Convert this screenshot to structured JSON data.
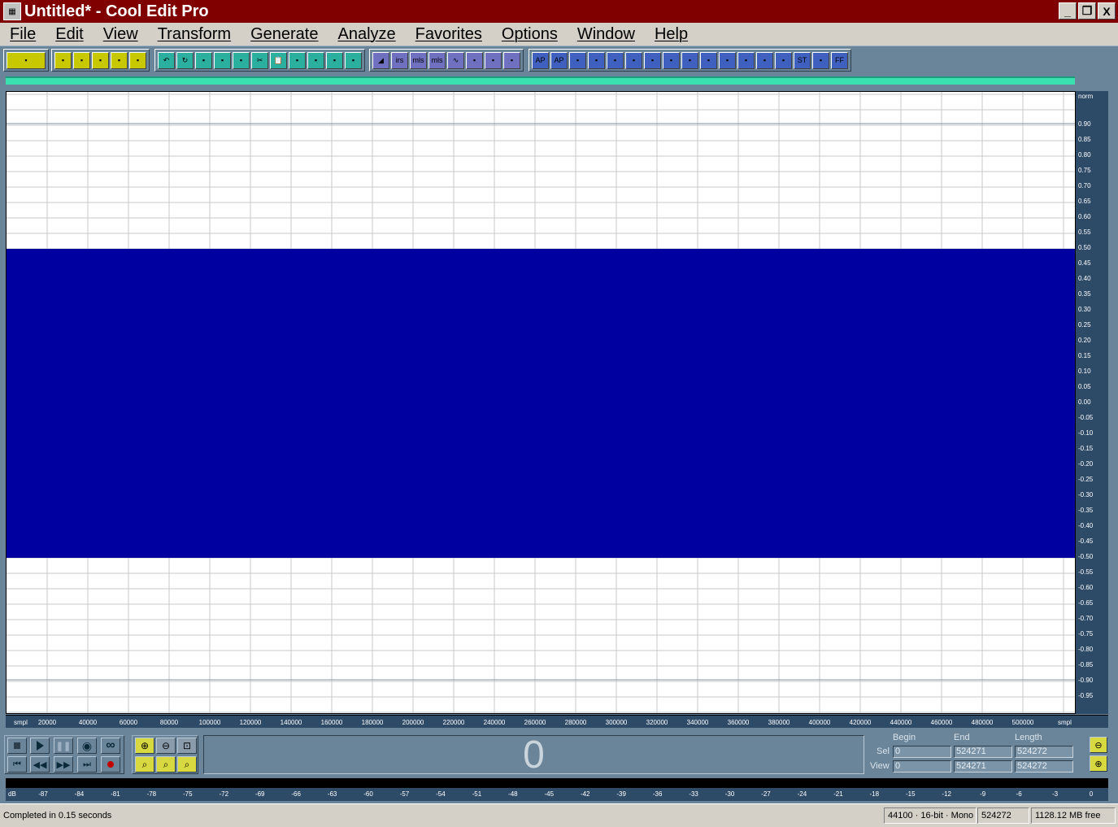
{
  "window": {
    "title": "Untitled* - Cool Edit Pro",
    "controls": [
      "_",
      "❐",
      "X"
    ]
  },
  "menu": [
    "File",
    "Edit",
    "View",
    "Transform",
    "Generate",
    "Analyze",
    "Favorites",
    "Options",
    "Window",
    "Help"
  ],
  "toolbar": {
    "groups": [
      {
        "name": "mode",
        "color": "#c8c800",
        "buttons": [
          "multitrack-view"
        ]
      },
      {
        "name": "file",
        "color": "#c8c800",
        "buttons": [
          "new-file",
          "open-file",
          "close-file",
          "save-file",
          "save-all"
        ]
      },
      {
        "name": "edit",
        "color": "#2bb0a0",
        "buttons": [
          "undo",
          "repeat",
          "cut-marker",
          "select-all",
          "copy-to-new",
          "cut",
          "paste",
          "paste-mix",
          "paste-new",
          "trim",
          "crop"
        ]
      },
      {
        "name": "effects-a",
        "color": "#7070c0",
        "buttons": [
          "amplify",
          "irs",
          "mls",
          "mls2",
          "envelope",
          "noise-reduction",
          "convolution",
          "stretch"
        ]
      },
      {
        "name": "effects-b",
        "color": "#4060c0",
        "buttons": [
          "ap",
          "ap32",
          "wave-b",
          "ratio",
          "ratio-b",
          "flag-1",
          "flag-2",
          "flag-3",
          "flag-4",
          "flag-5",
          "flag-6",
          "sun-fx",
          "circle-g",
          "circle-w",
          "st",
          "circle-s",
          "ff"
        ]
      }
    ]
  },
  "waveform": {
    "fill_color": "#0000a0",
    "top_level": 0.5,
    "bottom_level": -0.5,
    "grid_color": "#c8c8c8"
  },
  "y_ruler": {
    "unit": "norm",
    "labels": [
      "0.90",
      "0.85",
      "0.80",
      "0.75",
      "0.70",
      "0.65",
      "0.60",
      "0.55",
      "0.50",
      "0.45",
      "0.40",
      "0.35",
      "0.30",
      "0.25",
      "0.20",
      "0.15",
      "0.10",
      "0.05",
      "0.00",
      "-0.05",
      "-0.10",
      "-0.15",
      "-0.20",
      "-0.25",
      "-0.30",
      "-0.35",
      "-0.40",
      "-0.45",
      "-0.50",
      "-0.55",
      "-0.60",
      "-0.65",
      "-0.70",
      "-0.75",
      "-0.80",
      "-0.85",
      "-0.90",
      "-0.95"
    ]
  },
  "x_ruler": {
    "unit": "smpl",
    "labels": [
      "20000",
      "40000",
      "60000",
      "80000",
      "100000",
      "120000",
      "140000",
      "160000",
      "180000",
      "200000",
      "220000",
      "240000",
      "260000",
      "280000",
      "300000",
      "320000",
      "340000",
      "360000",
      "380000",
      "400000",
      "420000",
      "440000",
      "460000",
      "480000",
      "500000"
    ]
  },
  "transport": {
    "time_display": "0",
    "headers": {
      "begin": "Begin",
      "end": "End",
      "length": "Length"
    },
    "sel": {
      "label": "Sel",
      "begin": "0",
      "end": "524271",
      "length": "524272"
    },
    "view": {
      "label": "View",
      "begin": "0",
      "end": "524271",
      "length": "524272"
    }
  },
  "db_ruler": {
    "unit": "dB",
    "labels": [
      "-87",
      "-84",
      "-81",
      "-78",
      "-75",
      "-72",
      "-69",
      "-66",
      "-63",
      "-60",
      "-57",
      "-54",
      "-51",
      "-48",
      "-45",
      "-42",
      "-39",
      "-36",
      "-33",
      "-30",
      "-27",
      "-24",
      "-21",
      "-18",
      "-15",
      "-12",
      "-9",
      "-6",
      "-3",
      "0"
    ]
  },
  "status": {
    "message": "Completed in 0.15 seconds",
    "format": "44100 · 16-bit · Mono",
    "samples": "524272",
    "disk_free": "1128.12 MB free"
  }
}
